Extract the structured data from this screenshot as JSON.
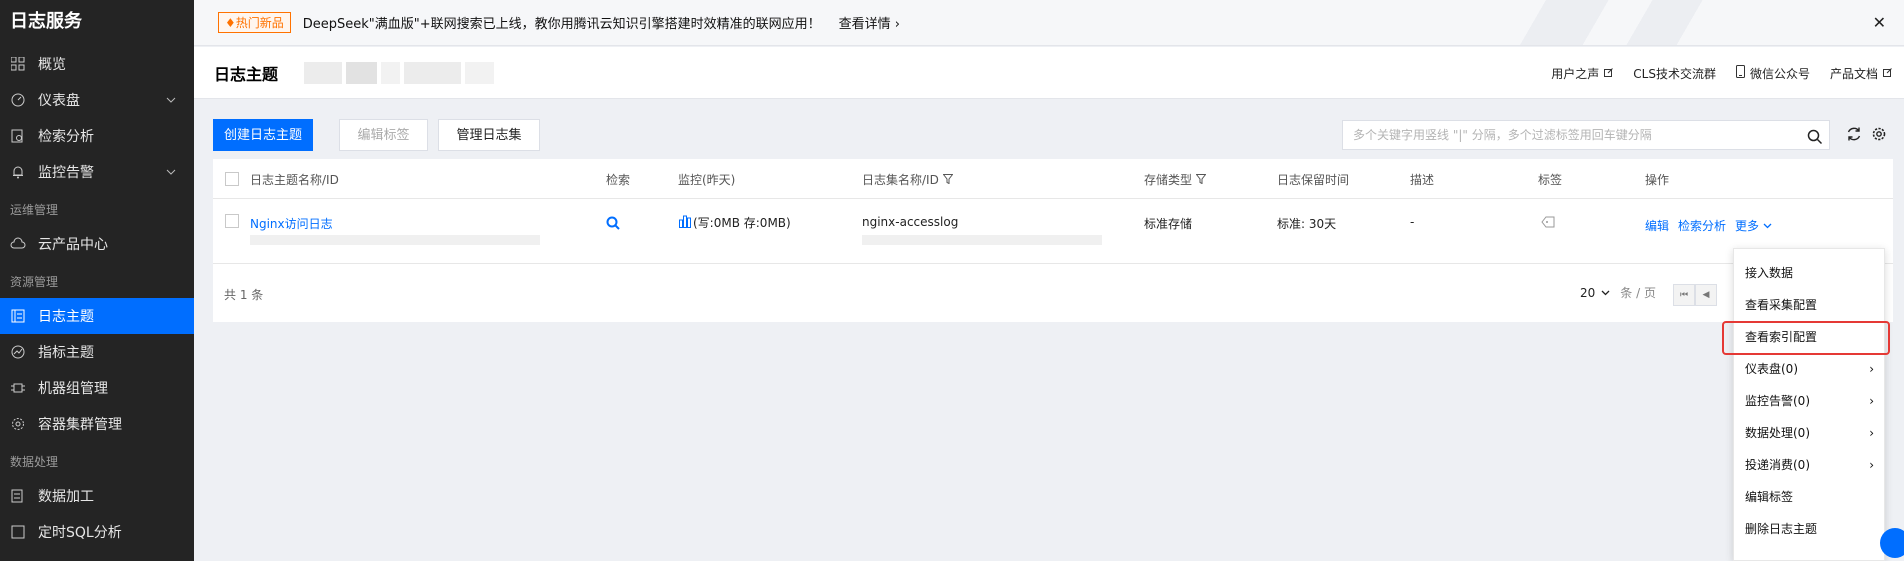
{
  "sidebar": {
    "brand": "日志服务",
    "items": [
      {
        "label": "概览"
      },
      {
        "label": "仪表盘"
      },
      {
        "label": "检索分析"
      },
      {
        "label": "监控告警"
      }
    ],
    "group_ops": "运维管理",
    "cloud_center": "云产品中心",
    "group_res": "资源管理",
    "res_items": [
      {
        "label": "日志主题"
      },
      {
        "label": "指标主题"
      },
      {
        "label": "机器组管理"
      },
      {
        "label": "容器集群管理"
      }
    ],
    "group_data": "数据处理",
    "data_items": [
      {
        "label": "数据加工"
      },
      {
        "label": "定时SQL分析"
      }
    ]
  },
  "banner": {
    "badge": "♦热门新品",
    "text": "DeepSeek\"满血版\"+联网搜索已上线，教你用腾讯云知识引擎搭建时效精准的联网应用！",
    "link": "查看详情 ›"
  },
  "header": {
    "title": "日志主题",
    "links": [
      "用户之声",
      "CLS技术交流群",
      "微信公众号",
      "产品文档"
    ]
  },
  "toolbar": {
    "create": "创建日志主题",
    "edit_tags": "编辑标签",
    "manage_sets": "管理日志集",
    "search_placeholder": "多个关键字用竖线 \"|\" 分隔，多个过滤标签用回车键分隔"
  },
  "table": {
    "columns": [
      "日志主题名称/ID",
      "检索",
      "监控(昨天)",
      "日志集名称/ID",
      "存储类型",
      "日志保留时间",
      "描述",
      "标签",
      "操作"
    ],
    "rows": [
      {
        "name": "Nginx访问日志",
        "monitor": "(写:0MB  存:0MB)",
        "logset": "nginx-accesslog",
        "storage": "标准存储",
        "retention": "标准: 30天",
        "desc": "-",
        "actions": [
          "编辑",
          "检索分析",
          "更多"
        ]
      }
    ],
    "total": "共 1 条",
    "page_size": "20",
    "page_unit": "条 / 页"
  },
  "more_menu": {
    "items": [
      {
        "label": "接入数据",
        "sub": false
      },
      {
        "label": "查看采集配置",
        "sub": false
      },
      {
        "label": "查看索引配置",
        "sub": false
      },
      {
        "label": "仪表盘(0)",
        "sub": true
      },
      {
        "label": "监控告警(0)",
        "sub": true
      },
      {
        "label": "数据处理(0)",
        "sub": true
      },
      {
        "label": "投递消费(0)",
        "sub": true
      },
      {
        "label": "编辑标签",
        "sub": false
      },
      {
        "label": "删除日志主题",
        "sub": false
      }
    ],
    "highlighted_index": 2
  },
  "colors": {
    "primary": "#006eff",
    "sidebar_bg": "#242424",
    "highlight": "#e53935",
    "hot": "#ff7200"
  }
}
